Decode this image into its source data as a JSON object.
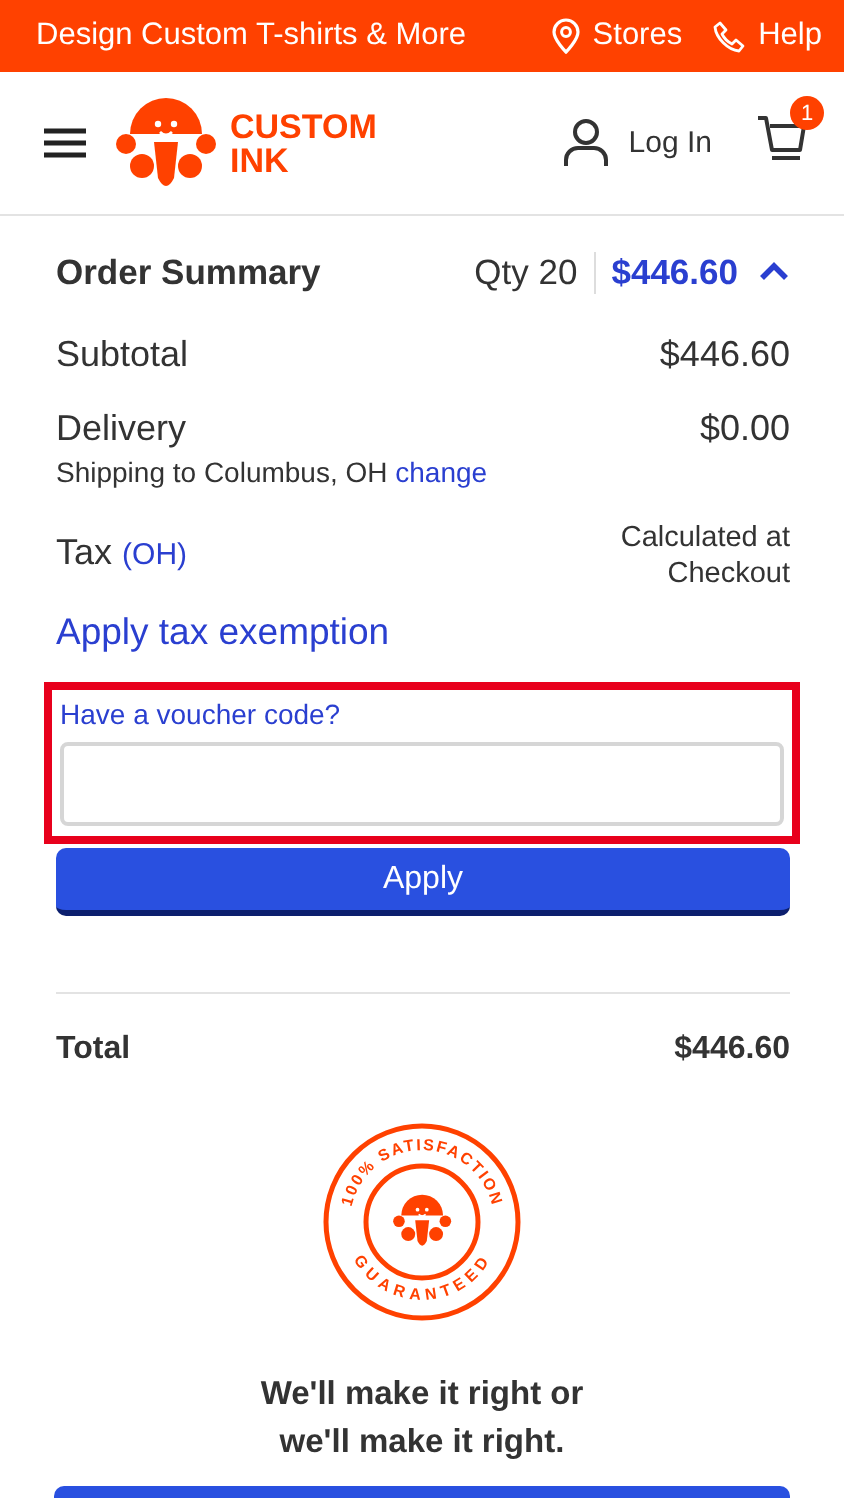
{
  "top_bar": {
    "promo": "Design Custom T-shirts & More",
    "links": [
      {
        "kind": "stores",
        "label": "Stores"
      },
      {
        "kind": "help",
        "label": "Help"
      }
    ]
  },
  "header": {
    "logo": [
      "CUSTOM",
      "INK"
    ],
    "login": "Log In",
    "cart_count": "1"
  },
  "order_summary": {
    "title": "Order Summary",
    "qty": "Qty 20",
    "total": "$446.60",
    "expanded": true
  },
  "lines": [
    {
      "kind": "amount",
      "label": "Subtotal",
      "value": "$446.60"
    },
    {
      "kind": "delivery",
      "label": "Delivery",
      "value": "$0.00",
      "note": "Shipping to Columbus, OH",
      "link": "change"
    },
    {
      "kind": "tax",
      "label": "Tax",
      "region": "(OH)",
      "value": "Calculated at Checkout"
    }
  ],
  "tax_exemption_link": "Apply tax exemption",
  "voucher": {
    "label": "Have a voucher code?",
    "highlighted": true,
    "button": "Apply"
  },
  "total": {
    "label": "Total",
    "value": "$446.60"
  },
  "guarantee": {
    "badge_top": "100% SATISFACTION",
    "badge_bottom": "GUARANTEED",
    "text": "We'll make it right or we'll make it right."
  }
}
